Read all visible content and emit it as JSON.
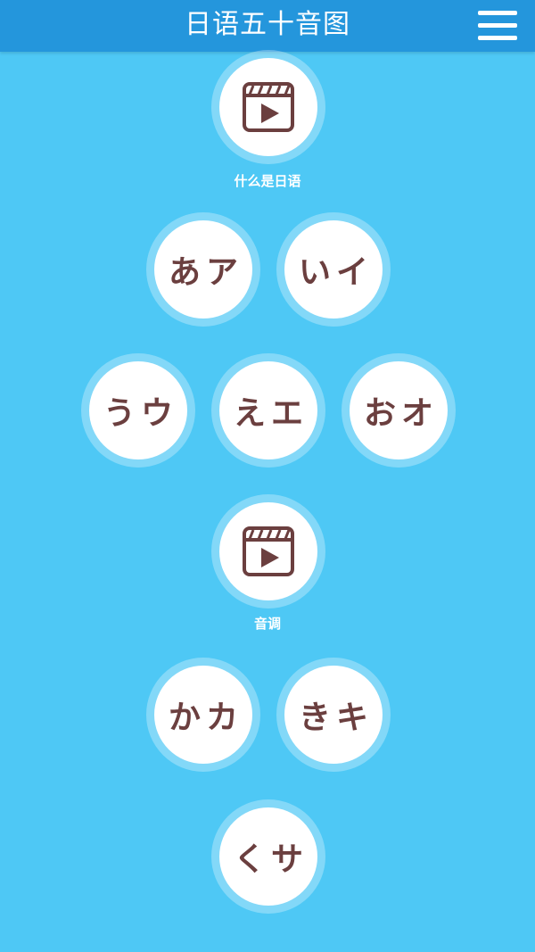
{
  "header": {
    "title": "日语五十音图",
    "menu_icon": "hamburger-menu-icon",
    "color": "#2496dc"
  },
  "background_color": "#4ec8f5",
  "video_1": {
    "label": "什么是日语",
    "icon": "video-play-icon"
  },
  "kana": {
    "a": "あア",
    "i": "いイ",
    "u": "うウ",
    "e": "えエ",
    "o": "おオ",
    "ka": "かカ",
    "ki": "きキ",
    "ku": "くサ"
  },
  "video_2": {
    "label": "音调",
    "icon": "video-play-icon"
  },
  "text_color": "#6b3f3f"
}
